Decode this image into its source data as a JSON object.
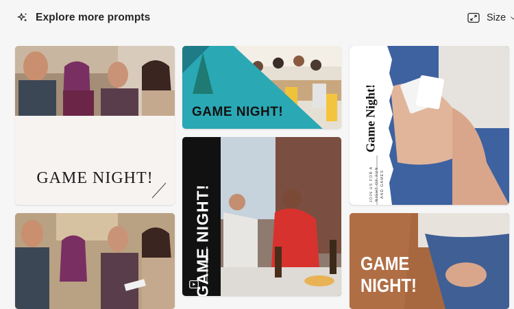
{
  "header": {
    "explore_label": "Explore more prompts",
    "size_label": "Size"
  },
  "cards": [
    {
      "title": "GAME NIGHT!"
    },
    {
      "title": "GAME NIGHT!"
    },
    {
      "title": "Game Night!",
      "subtitle": "JOIN US FOR A NIGHT OF FUN AND GAMES"
    },
    {
      "title": "GAME NIGHT!"
    },
    {
      "title": ""
    },
    {
      "title": "GAME NIGHT!"
    }
  ],
  "colors": {
    "background": "#f7f6f6",
    "teal_accent": "#2aa8b4",
    "text_primary": "#242424"
  },
  "icons": {
    "explore": "sparkle-icon",
    "size": "resize-icon",
    "chevron": "chevron-down-icon",
    "video": "video-icon"
  }
}
